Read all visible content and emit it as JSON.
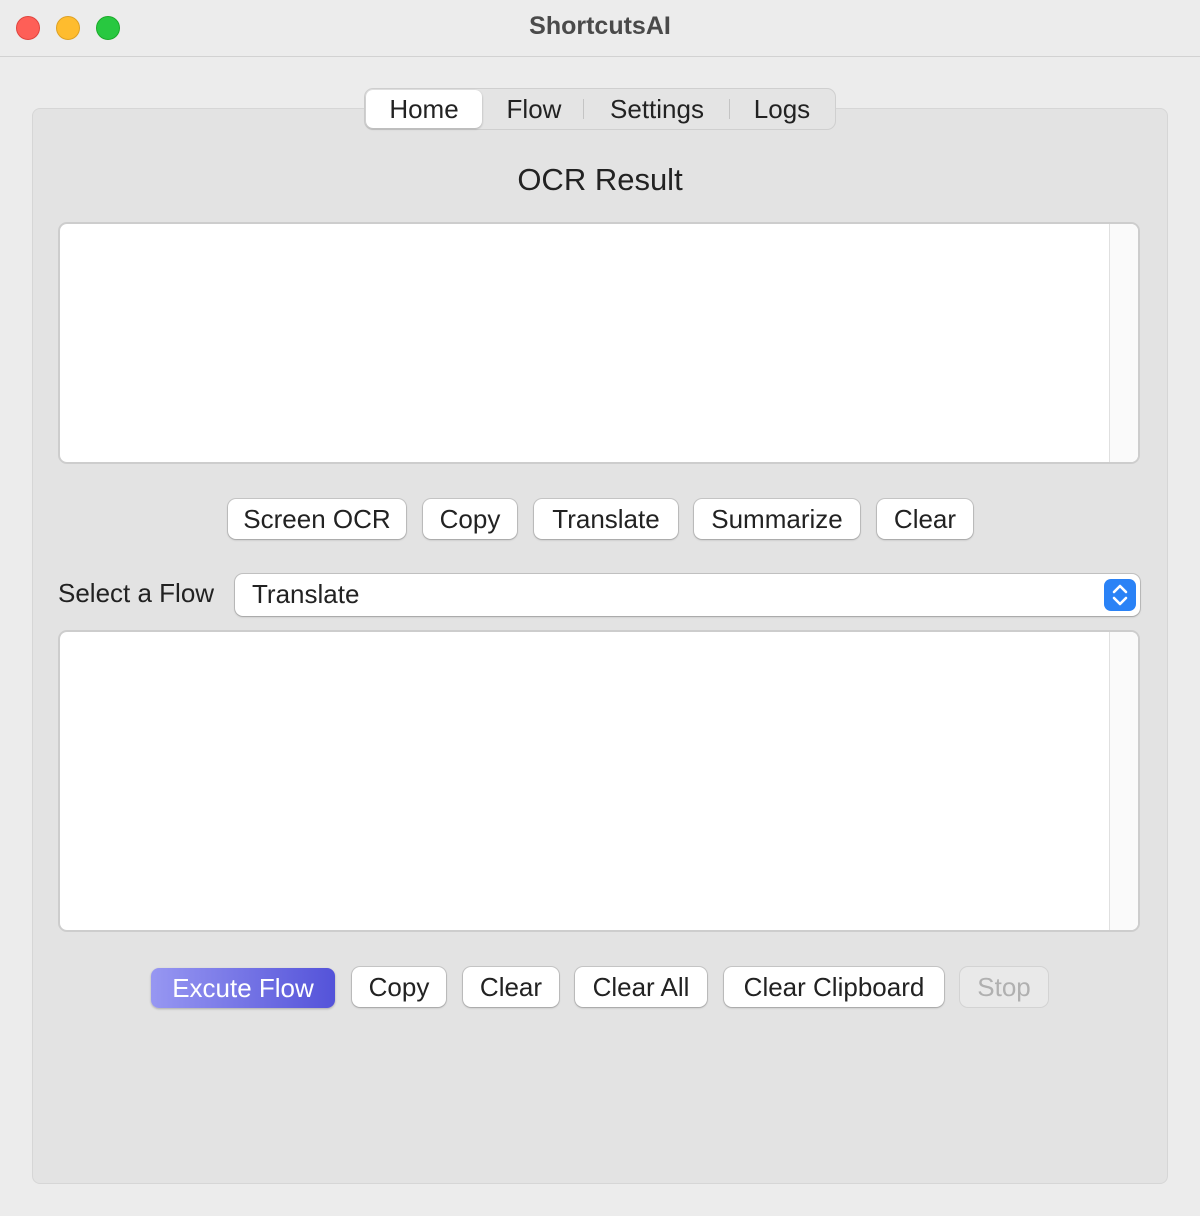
{
  "window": {
    "title": "ShortcutsAI"
  },
  "tabs": [
    {
      "label": "Home",
      "active": true
    },
    {
      "label": "Flow",
      "active": false
    },
    {
      "label": "Settings",
      "active": false
    },
    {
      "label": "Logs",
      "active": false
    }
  ],
  "ocr": {
    "heading": "OCR Result",
    "text": "",
    "buttons": {
      "screen_ocr": "Screen OCR",
      "copy": "Copy",
      "translate": "Translate",
      "summarize": "Summarize",
      "clear": "Clear"
    }
  },
  "flow": {
    "label": "Select a Flow",
    "selected": "Translate",
    "output_text": "",
    "buttons": {
      "execute": "Excute Flow",
      "copy": "Copy",
      "clear": "Clear",
      "clear_all": "Clear All",
      "clear_clipboard": "Clear Clipboard",
      "stop": "Stop"
    }
  },
  "colors": {
    "accent_start": "#9797f2",
    "accent_end": "#5453d9",
    "select_stepper": "#2a82f6",
    "close": "#fe5f57",
    "minimize": "#febc2e",
    "maximize": "#28c840"
  }
}
